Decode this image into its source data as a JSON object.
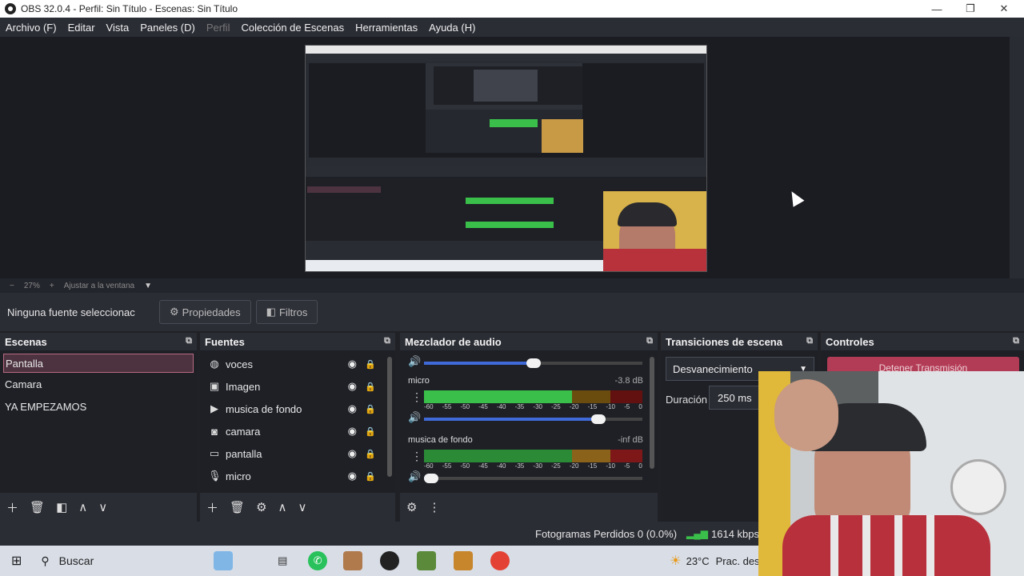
{
  "window": {
    "title": "OBS 32.0.4 - Perfil: Sin Título - Escenas: Sin Título"
  },
  "menu": [
    "Archivo (F)",
    "Editar",
    "Vista",
    "Paneles (D)",
    "Perfil",
    "Colección de Escenas",
    "Herramientas",
    "Ayuda (H)"
  ],
  "zoom": {
    "minus": "−",
    "value": "27%",
    "plus": "+",
    "fit": "Ajustar a la ventana"
  },
  "source_bar": {
    "none_selected": "Ninguna fuente seleccionac",
    "properties": "Propiedades",
    "filters": "Filtros"
  },
  "scenes": {
    "title": "Escenas",
    "items": [
      "Pantalla",
      "Camara",
      "YA EMPEZAMOS"
    ]
  },
  "sources": {
    "title": "Fuentes",
    "items": [
      {
        "label": "voces",
        "icon": "globe-icon"
      },
      {
        "label": "Imagen",
        "icon": "image-icon"
      },
      {
        "label": "musica de fondo",
        "icon": "play-icon"
      },
      {
        "label": "camara",
        "icon": "camera-icon"
      },
      {
        "label": "pantalla",
        "icon": "monitor-icon"
      },
      {
        "label": "micro",
        "icon": "mic-icon"
      }
    ]
  },
  "mixer": {
    "title": "Mezclador de audio",
    "ticks": [
      "-60",
      "-55",
      "-50",
      "-45",
      "-40",
      "-35",
      "-30",
      "-25",
      "-20",
      "-15",
      "-10",
      "-5",
      "0"
    ],
    "channels": [
      {
        "name": "micro",
        "db": "-3.8 dB",
        "fader": 0.8
      },
      {
        "name": "musica de fondo",
        "db": "-inf dB",
        "fader": 0.03
      }
    ],
    "top_fader": 0.5
  },
  "transitions": {
    "title": "Transiciones de escena",
    "selected": "Desvanecimiento",
    "duration_label": "Duración",
    "duration_value": "250 ms"
  },
  "controls": {
    "title": "Controles",
    "stop_stream": "Detener Transmisión"
  },
  "status": {
    "dropped": "Fotogramas Perdidos 0 (0.0%)",
    "bitrate": "1614 kbps"
  },
  "taskbar": {
    "search": "Buscar",
    "weather_temp": "23°C",
    "weather_text": "Prac. desp"
  }
}
